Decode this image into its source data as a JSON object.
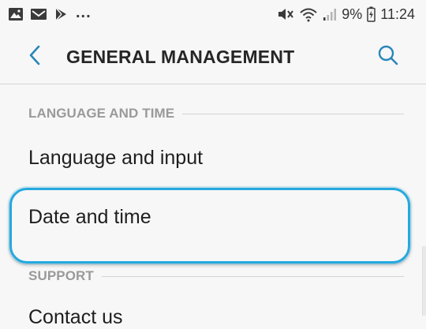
{
  "status_bar": {
    "left_icons": [
      "gallery-icon",
      "email-icon",
      "play-store-icon"
    ],
    "overflow": "...",
    "right_icons": [
      "mute-icon",
      "wifi-icon",
      "signal-icon",
      "battery-icon"
    ],
    "battery": "9%",
    "time": "11:24"
  },
  "header": {
    "back_icon": "chevron-left-icon",
    "title": "GENERAL MANAGEMENT",
    "search_icon": "search-icon",
    "accent_color": "#2a86b9"
  },
  "sections": [
    {
      "header": "LANGUAGE AND TIME",
      "items": [
        "Language and input",
        "Date and time"
      ]
    },
    {
      "header": "SUPPORT",
      "items": [
        "Contact us"
      ]
    }
  ],
  "highlight": {
    "target": "Date and time",
    "color": "#24a9df"
  }
}
